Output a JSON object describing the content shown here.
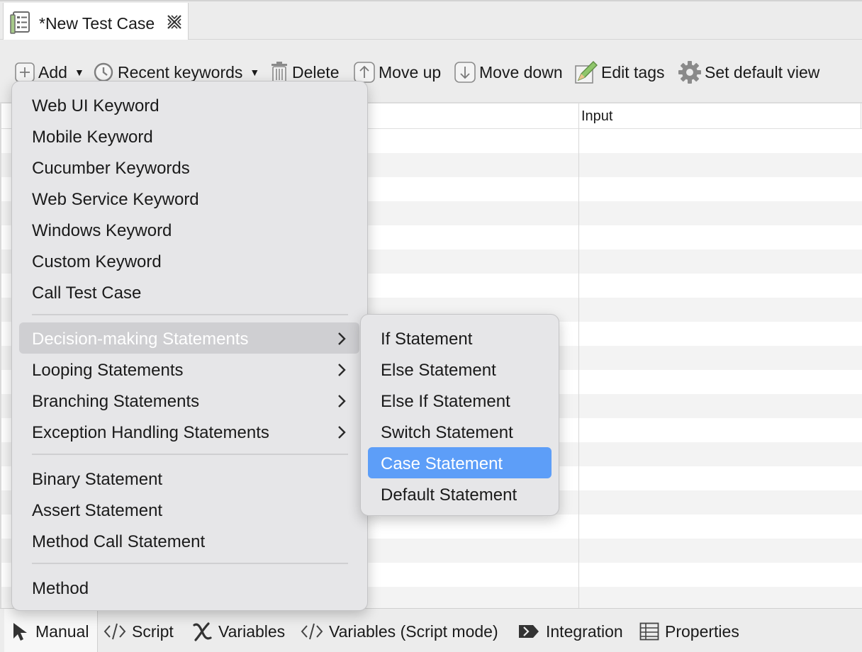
{
  "tab": {
    "title": "*New Test Case"
  },
  "toolbar": {
    "add": "Add",
    "recent_keywords": "Recent keywords",
    "delete": "Delete",
    "move_up": "Move up",
    "move_down": "Move down",
    "edit_tags": "Edit tags",
    "set_default_view": "Set default view"
  },
  "table": {
    "column_input": "Input"
  },
  "add_menu": {
    "keywords": [
      "Web UI Keyword",
      "Mobile Keyword",
      "Cucumber Keywords",
      "Web Service Keyword",
      "Windows Keyword",
      "Custom Keyword",
      "Call Test Case"
    ],
    "statements": [
      "Decision-making Statements",
      "Looping Statements",
      "Branching Statements",
      "Exception Handling Statements"
    ],
    "others": [
      "Binary Statement",
      "Assert Statement",
      "Method Call Statement"
    ],
    "method": "Method",
    "highlighted": "Decision-making Statements"
  },
  "decision_submenu": {
    "items": [
      "If Statement",
      "Else Statement",
      "Else If Statement",
      "Switch Statement",
      "Case Statement",
      "Default Statement"
    ],
    "selected": "Case Statement"
  },
  "bottom_tabs": {
    "manual": "Manual",
    "script": "Script",
    "variables": "Variables",
    "variables_script": "Variables (Script mode)",
    "integration": "Integration",
    "properties": "Properties",
    "active": "Manual"
  },
  "colors": {
    "selection_blue": "#5d9ef8",
    "hover_grey": "#cfcfd2",
    "menu_bg": "#e6e6e8"
  }
}
